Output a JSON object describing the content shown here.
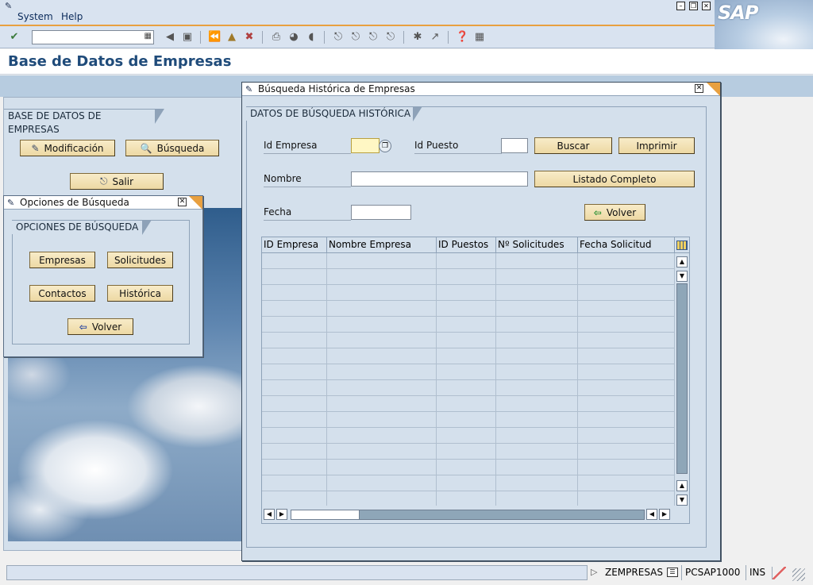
{
  "menu": {
    "items": [
      "System",
      "Help"
    ]
  },
  "window": {
    "minimize_icon": "minimize-icon",
    "restore_icon": "restore-icon",
    "close_icon": "close-icon"
  },
  "logo": {
    "text": "SAP"
  },
  "toolbar": {
    "command_value": "",
    "icons": [
      "enter-icon",
      "back-icon",
      "save-icon",
      "back-nav-icon",
      "exit-icon",
      "cancel-icon",
      "print-icon",
      "find-icon",
      "find-next-icon",
      "first-page-icon",
      "previous-page-icon",
      "next-page-icon",
      "last-page-icon",
      "new-session-icon",
      "shortcut-icon",
      "help-icon",
      "layout-icon"
    ]
  },
  "page": {
    "title": "Base de Datos de Empresas"
  },
  "main": {
    "group_title": "BASE DE DATOS DE EMPRESAS",
    "buttons": {
      "modificacion": "Modificación",
      "busqueda": "Búsqueda",
      "salir": "Salir"
    }
  },
  "popup_opciones": {
    "title": "Opciones de Búsqueda",
    "group_title": "OPCIONES DE BÚSQUEDA",
    "buttons": {
      "empresas": "Empresas",
      "solicitudes": "Solicitudes",
      "contactos": "Contactos",
      "historica": "Histórica",
      "volver": "Volver"
    }
  },
  "popup_historica": {
    "title": "Búsqueda Histórica de Empresas",
    "group_title": "DATOS DE BÚSQUEDA HISTÓRICA",
    "fields": {
      "id_empresa_label": "Id Empresa",
      "id_empresa_value": "",
      "id_puesto_label": "Id Puesto",
      "id_puesto_value": "",
      "nombre_label": "Nombre",
      "nombre_value": "",
      "fecha_label": "Fecha",
      "fecha_value": ""
    },
    "buttons": {
      "buscar": "Buscar",
      "imprimir": "Imprimir",
      "listado": "Listado Completo",
      "volver": "Volver"
    },
    "table": {
      "columns": [
        "ID Empresa",
        "Nombre Empresa",
        "ID Puestos",
        "Nº Solicitudes",
        "Fecha Solicitud"
      ],
      "visible_rows": 16,
      "config_icon": "table-settings-icon",
      "vertical_scroll_position": 0,
      "horizontal_scroll_position": 0
    }
  },
  "status": {
    "transaction": "ZEMPRESAS",
    "server": "PCSAP1000",
    "mode": "INS"
  }
}
